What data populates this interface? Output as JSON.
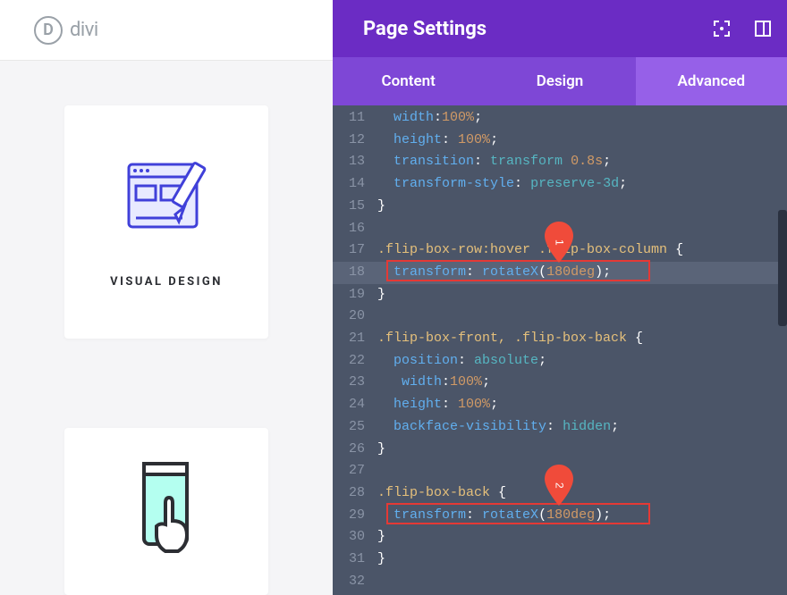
{
  "logo_letter": "D",
  "logo_text": "divi",
  "cards": {
    "visual_design": {
      "title": "VISUAL DESIGN"
    }
  },
  "panel": {
    "title": "Page Settings",
    "tabs": {
      "content": "Content",
      "design": "Design",
      "advanced": "Advanced",
      "active": "advanced"
    }
  },
  "code": {
    "11": {
      "indent": "  ",
      "prop": "width",
      "sep": ":",
      "val": "100%",
      "tail": ";"
    },
    "12": {
      "indent": "  ",
      "prop": "height",
      "sep": ": ",
      "val": "100%",
      "tail": ";"
    },
    "13": {
      "indent": "  ",
      "prop": "transition",
      "sep": ": ",
      "val1": "transform",
      "val2": "0.8s",
      "tail": ";"
    },
    "14": {
      "indent": "  ",
      "prop": "transform-style",
      "sep": ": ",
      "val": "preserve-3d",
      "tail": ";"
    },
    "15": {
      "text": "}"
    },
    "16": {
      "text": ""
    },
    "17": {
      "sel": ".flip-box-row:hover .flip-box-column",
      "brace": " {"
    },
    "18": {
      "indent": "  ",
      "prop": "transform",
      "sep": ": ",
      "fn": "rotateX",
      "arg": "180deg",
      "tail": ";"
    },
    "19": {
      "text": "}"
    },
    "20": {
      "text": ""
    },
    "21": {
      "sel": ".flip-box-front, .flip-box-back",
      "brace": " {"
    },
    "22": {
      "indent": "  ",
      "prop": "position",
      "sep": ": ",
      "val": "absolute",
      "tail": ";"
    },
    "23": {
      "indent": "   ",
      "prop": "width",
      "sep": ":",
      "val": "100%",
      "tail": ";"
    },
    "24": {
      "indent": "  ",
      "prop": "height",
      "sep": ": ",
      "val": "100%",
      "tail": ";"
    },
    "25": {
      "indent": "  ",
      "prop": "backface-visibility",
      "sep": ": ",
      "val": "hidden",
      "tail": ";"
    },
    "26": {
      "text": "}"
    },
    "27": {
      "text": ""
    },
    "28": {
      "sel": ".flip-box-back",
      "brace": " {"
    },
    "29": {
      "indent": "  ",
      "prop": "transform",
      "sep": ": ",
      "fn": "rotateX",
      "arg": "180deg",
      "tail": ";"
    },
    "30": {
      "text": "}"
    },
    "31": {
      "text": "}"
    },
    "32": {
      "text": ""
    }
  },
  "markers": {
    "1": "1",
    "2": "2"
  }
}
